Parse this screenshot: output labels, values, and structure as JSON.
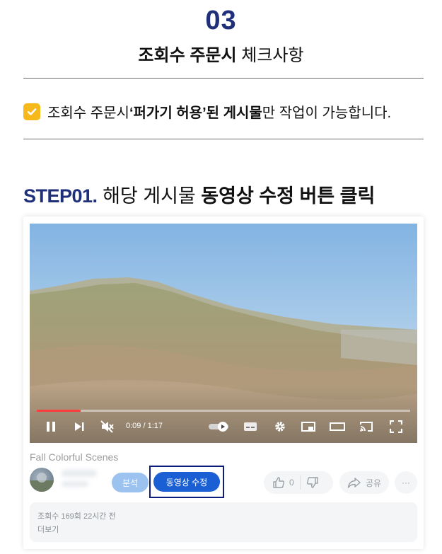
{
  "section": {
    "number": "03",
    "title_bold": "조회수 주문시",
    "title_rest": " 체크사항"
  },
  "notice": {
    "prefix": "조회수 주문시 ",
    "bold": "‘퍼가기 허용’된 게시물",
    "suffix": "만 작업이 가능합니다."
  },
  "step": {
    "label": "STEP01.",
    "text": " 해당 게시물 ",
    "bold": "동영상 수정 버튼 클릭"
  },
  "player": {
    "time": "0:09 / 1:17",
    "progress": 0.117
  },
  "video": {
    "title": "Fall Colorful Scenes",
    "analytics_label": "분석",
    "edit_label": "동영상 수정",
    "like_count": "0",
    "share_label": "공유",
    "more_label": "···",
    "stats": "조회수 169회  22시간 전",
    "more_text": "더보기"
  },
  "colors": {
    "brand_navy": "#1f2f7a",
    "check_yellow": "#f6b81a",
    "edit_button": "#1a5fd4",
    "analytics_button": "#9cc3ef",
    "highlight_border": "#0d1d7e",
    "progress": "#ff3b3b"
  }
}
